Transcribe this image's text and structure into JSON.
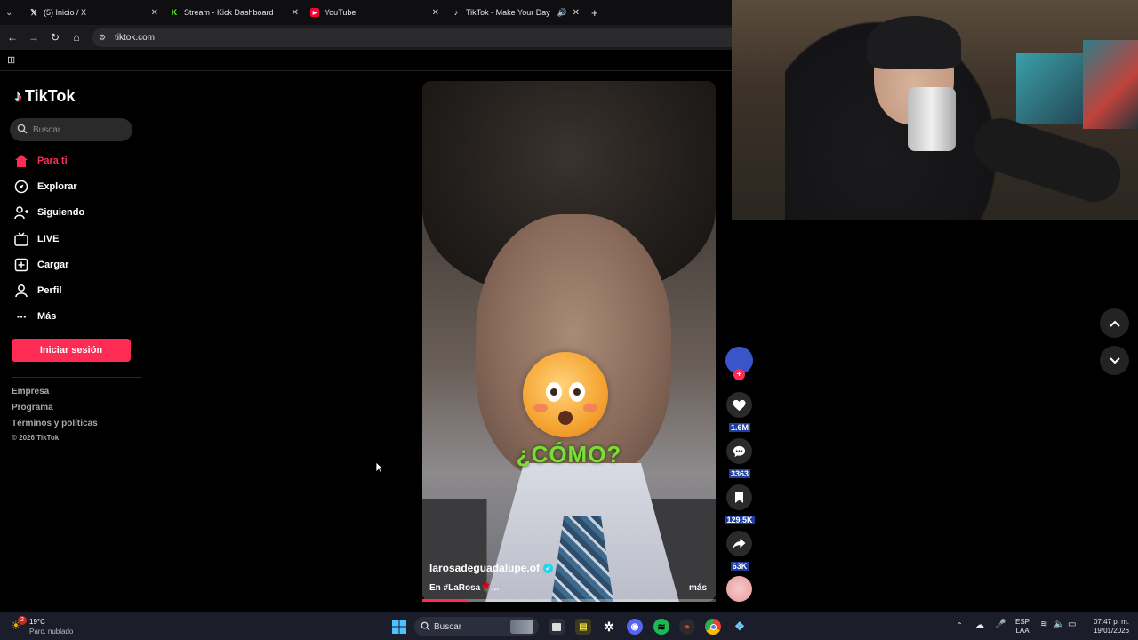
{
  "browser": {
    "tabs": [
      {
        "title": "(5) Inicio / X",
        "icon": "x-logo-icon"
      },
      {
        "title": "Stream - Kick Dashboard",
        "icon": "kick-logo-icon"
      },
      {
        "title": "YouTube",
        "icon": "youtube-logo-icon"
      },
      {
        "title": "TikTok - Make Your Day",
        "icon": "tiktok-logo-icon",
        "active": true
      }
    ],
    "url": "tiktok.com"
  },
  "tiktok": {
    "logo": "TikTok",
    "search_placeholder": "Buscar",
    "nav": [
      {
        "label": "Para ti",
        "icon": "home-icon",
        "active": true
      },
      {
        "label": "Explorar",
        "icon": "compass-icon"
      },
      {
        "label": "Siguiendo",
        "icon": "following-icon"
      },
      {
        "label": "LIVE",
        "icon": "live-tv-icon"
      },
      {
        "label": "Cargar",
        "icon": "upload-icon"
      },
      {
        "label": "Perfil",
        "icon": "profile-icon"
      },
      {
        "label": "Más",
        "icon": "more-dots-icon"
      }
    ],
    "login_button": "Iniciar sesión",
    "footer": {
      "links": [
        "Empresa",
        "Programa",
        "Términos y políticas"
      ],
      "copyright": "© 2026 TikTok"
    },
    "accent_color": "#fe2c55",
    "video": {
      "overlay_text": "¿CÓMO?",
      "username": "larosadeguadalupe.of",
      "verified": true,
      "description": "En #LaRosa🌹...",
      "more_label": "más",
      "progress": 0.15
    },
    "actions": {
      "likes": "1.6M",
      "comments": "3363",
      "saves": "129.5K",
      "shares": "63K"
    }
  },
  "taskbar": {
    "weather": {
      "temp": "19°C",
      "condition": "Parc. nublado",
      "badge": "2"
    },
    "search_placeholder": "Buscar",
    "language": {
      "lang": "ESP",
      "layout": "LAA"
    },
    "clock": {
      "time": "07:47 p. m.",
      "date": "19/01/2026"
    }
  }
}
